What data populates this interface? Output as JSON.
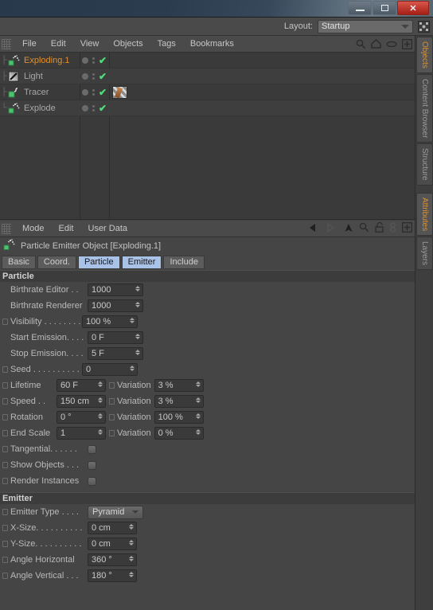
{
  "window": {
    "minimize_label": "–",
    "maximize_label": "□",
    "close_label": "✕"
  },
  "layout_bar": {
    "label": "Layout:",
    "selected": "Startup",
    "expand_icon": "expand-icon"
  },
  "object_manager": {
    "menu": [
      "File",
      "Edit",
      "View",
      "Objects",
      "Tags",
      "Bookmarks"
    ],
    "tools": [
      "search-icon",
      "home-icon",
      "eye-icon",
      "plus-box-icon"
    ],
    "objects": [
      {
        "name": "Exploding.1",
        "icon": "particle-emitter-icon",
        "selected": true,
        "has_tag": false
      },
      {
        "name": "Light",
        "icon": "light-icon",
        "selected": false,
        "has_tag": false
      },
      {
        "name": "Tracer",
        "icon": "tracer-icon",
        "selected": false,
        "has_tag": true
      },
      {
        "name": "Explode",
        "icon": "particle-emitter-icon",
        "selected": false,
        "has_tag": false
      }
    ],
    "row_visible_check": "✔"
  },
  "attribute_manager": {
    "menu": [
      "Mode",
      "Edit",
      "User Data"
    ],
    "tools": [
      "back-arrow-icon",
      "forward-arrow-icon",
      "up-arrow-icon",
      "search-icon",
      "lock-icon",
      "link-icon",
      "plus-box-icon"
    ],
    "object_title": "Particle Emitter Object [Exploding.1]",
    "object_title_icon": "particle-emitter-icon",
    "tabs": [
      {
        "label": "Basic",
        "active": false
      },
      {
        "label": "Coord.",
        "active": false
      },
      {
        "label": "Particle",
        "active": true
      },
      {
        "label": "Emitter",
        "active": true
      },
      {
        "label": "Include",
        "active": false
      }
    ],
    "particle_section": {
      "title": "Particle",
      "rows": [
        {
          "type": "number",
          "checkbox": false,
          "label": "Birthrate Editor . .",
          "value": "1000"
        },
        {
          "type": "number",
          "checkbox": false,
          "label": "Birthrate Renderer",
          "value": "1000"
        },
        {
          "type": "number",
          "checkbox": true,
          "label": "Visibility . . . . . . . . .",
          "value": "100 %"
        },
        {
          "type": "number",
          "checkbox": false,
          "label": "Start Emission. . . .",
          "value": "0 F"
        },
        {
          "type": "number",
          "checkbox": false,
          "label": "Stop Emission. . . .",
          "value": "5 F"
        },
        {
          "type": "number",
          "checkbox": true,
          "label": "Seed . . . . . . . . . . .",
          "value": "0"
        }
      ],
      "variation_rows": [
        {
          "label": "Lifetime",
          "value": "60 F",
          "variation_label": "Variation",
          "variation_value": "3 %"
        },
        {
          "label": "Speed . .",
          "value": "150 cm",
          "variation_label": "Variation",
          "variation_value": "3 %"
        },
        {
          "label": "Rotation",
          "value": "0 °",
          "variation_label": "Variation",
          "variation_value": "100 %"
        },
        {
          "label": "End Scale",
          "value": "1",
          "variation_label": "Variation",
          "variation_value": "0 %"
        }
      ],
      "toggle_rows": [
        {
          "label": "Tangential. . . . . . ",
          "checked": false
        },
        {
          "label": "Show Objects . . .",
          "checked": false
        },
        {
          "label": "Render Instances",
          "checked": false
        }
      ]
    },
    "emitter_section": {
      "title": "Emitter",
      "rows": [
        {
          "type": "dropdown",
          "label": "Emitter Type . . . .",
          "value": "Pyramid"
        },
        {
          "type": "number",
          "label": "X-Size. . . . . . . . . .",
          "value": "0 cm"
        },
        {
          "type": "number",
          "label": "Y-Size. . . . . . . . . .",
          "value": "0 cm"
        },
        {
          "type": "number",
          "label": "Angle Horizontal",
          "value": "360 °"
        },
        {
          "type": "number",
          "label": "Angle Vertical . . .",
          "value": "180 °"
        }
      ]
    }
  },
  "sidebar": {
    "tabs": [
      {
        "label": "Objects",
        "active": true
      },
      {
        "label": "Content Browser",
        "active": false
      },
      {
        "label": "Structure",
        "active": false
      },
      {
        "label": "Attributes",
        "active": true
      },
      {
        "label": "Layers",
        "active": false
      }
    ]
  },
  "colors": {
    "accent_orange": "#e0902a",
    "tab_active": "#a8c2e8",
    "check_green": "#4fe07a",
    "panel_bg": "#454545"
  }
}
